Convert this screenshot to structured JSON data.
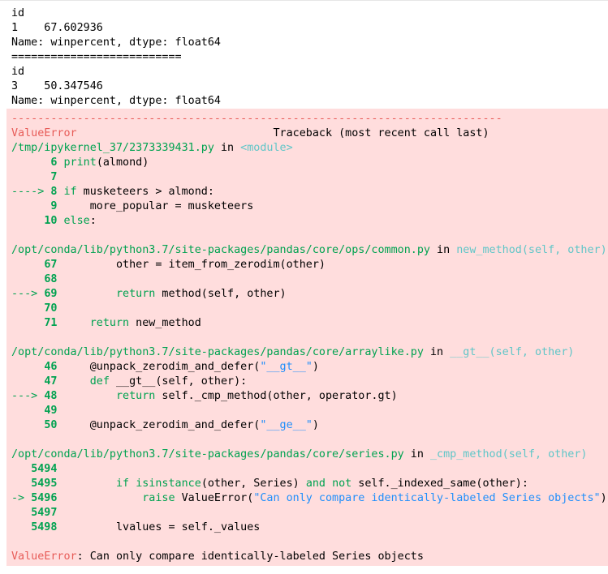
{
  "stdout": {
    "lines": [
      "id",
      "1    67.602936",
      "Name: winpercent, dtype: float64",
      "==========================",
      "id",
      "3    50.347546",
      "Name: winpercent, dtype: float64"
    ]
  },
  "traceback": {
    "separator": "---------------------------------------------------------------------------",
    "error_name": "ValueError",
    "header_gap": "                              ",
    "header_right": "Traceback (most recent call last)",
    "frames": [
      {
        "file": "/tmp/ipykernel_37/2373339431.py",
        "in_word": " in ",
        "func": "<module>",
        "lines": [
          {
            "prefix": "      ",
            "num": "6",
            "code": " print(almond)",
            "arrow": false
          },
          {
            "prefix": "      ",
            "num": "7",
            "code": "",
            "arrow": false
          },
          {
            "prefix": "----> ",
            "num": "8",
            "code": " if musketeers > almond:",
            "arrow": true
          },
          {
            "prefix": "      ",
            "num": "9",
            "code": "     more_popular = musketeers",
            "arrow": false
          },
          {
            "prefix": "     ",
            "num": "10",
            "code": " else:",
            "arrow": false
          }
        ]
      },
      {
        "file": "/opt/conda/lib/python3.7/site-packages/pandas/core/ops/common.py",
        "in_word": " in ",
        "func": "new_method(self, other)",
        "lines": [
          {
            "prefix": "     ",
            "num": "67",
            "code": "         other = item_from_zerodim(other)",
            "arrow": false
          },
          {
            "prefix": "     ",
            "num": "68",
            "code": "",
            "arrow": false
          },
          {
            "prefix": "---> ",
            "num": "69",
            "code": "         return method(self, other)",
            "arrow": true
          },
          {
            "prefix": "     ",
            "num": "70",
            "code": "",
            "arrow": false
          },
          {
            "prefix": "     ",
            "num": "71",
            "code": "     return new_method",
            "arrow": false
          }
        ]
      },
      {
        "file": "/opt/conda/lib/python3.7/site-packages/pandas/core/arraylike.py",
        "in_word": " in ",
        "func": "__gt__(self, other)",
        "lines": [
          {
            "prefix": "     ",
            "num": "46",
            "code": "     @unpack_zerodim_and_defer(\"__gt__\")",
            "arrow": false
          },
          {
            "prefix": "     ",
            "num": "47",
            "code": "     def __gt__(self, other):",
            "arrow": false
          },
          {
            "prefix": "---> ",
            "num": "48",
            "code": "         return self._cmp_method(other, operator.gt)",
            "arrow": true
          },
          {
            "prefix": "     ",
            "num": "49",
            "code": "",
            "arrow": false
          },
          {
            "prefix": "     ",
            "num": "50",
            "code": "     @unpack_zerodim_and_defer(\"__ge__\")",
            "arrow": false
          }
        ]
      },
      {
        "file": "/opt/conda/lib/python3.7/site-packages/pandas/core/series.py",
        "in_word": " in ",
        "func": "_cmp_method(self, other)",
        "lines": [
          {
            "prefix": "   ",
            "num": "5494",
            "code": "",
            "arrow": false
          },
          {
            "prefix": "   ",
            "num": "5495",
            "code": "         if isinstance(other, Series) and not self._indexed_same(other):",
            "arrow": false
          },
          {
            "prefix": "-> ",
            "num": "5496",
            "code": "             raise ValueError(\"Can only compare identically-labeled Series objects\")",
            "arrow": true
          },
          {
            "prefix": "   ",
            "num": "5497",
            "code": "",
            "arrow": false
          },
          {
            "prefix": "   ",
            "num": "5498",
            "code": "         lvalues = self._values",
            "arrow": false
          }
        ]
      }
    ],
    "final_error_name": "ValueError",
    "final_message": ": Can only compare identically-labeled Series objects"
  },
  "colors": {
    "stderr_bg": "#ffdddd",
    "error_red": "#e75c58",
    "line_green": "#00a250",
    "func_cyan": "#60c6c8"
  }
}
